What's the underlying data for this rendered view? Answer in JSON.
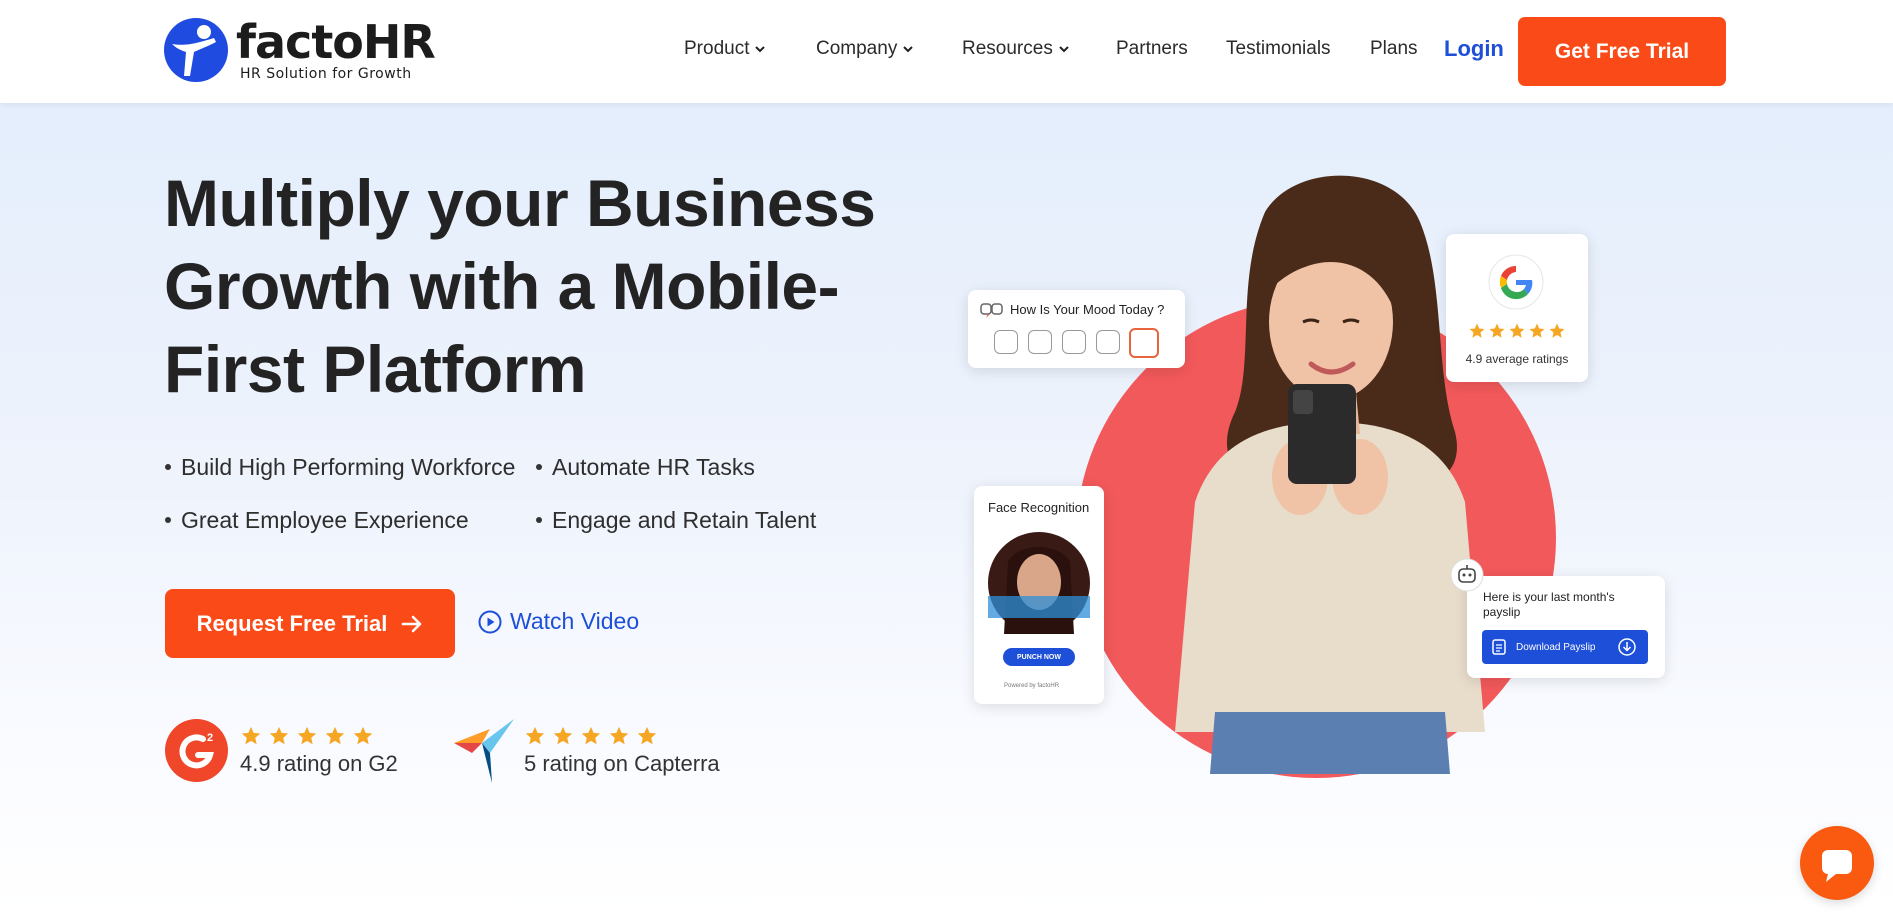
{
  "header": {
    "logo_name": "factoHR",
    "logo_tagline": "HR Solution for Growth",
    "nav": [
      {
        "label": "Product",
        "has_dropdown": true
      },
      {
        "label": "Company",
        "has_dropdown": true
      },
      {
        "label": "Resources",
        "has_dropdown": true
      },
      {
        "label": "Partners",
        "has_dropdown": false
      },
      {
        "label": "Testimonials",
        "has_dropdown": false
      },
      {
        "label": "Plans",
        "has_dropdown": false
      }
    ],
    "login_label": "Login",
    "cta_label": "Get Free Trial"
  },
  "hero": {
    "headline_lines": [
      "Multiply your Business",
      "Growth with a Mobile-",
      "First Platform"
    ],
    "bullets": [
      "Build High Performing Workforce",
      "Automate HR Tasks",
      "Great Employee Experience",
      "Engage and Retain Talent"
    ],
    "primary_cta": "Request Free Trial",
    "secondary_cta": "Watch Video",
    "ratings": [
      {
        "badge": "G2",
        "stars": 5,
        "text": "4.9 rating on G2"
      },
      {
        "badge": "Capterra",
        "stars": 5,
        "text": "5 rating on Capterra"
      }
    ]
  },
  "cards": {
    "mood": {
      "title": "How Is Your Mood Today ?"
    },
    "google": {
      "stars": 5,
      "text": "4.9 average ratings"
    },
    "face": {
      "title": "Face Recognition",
      "button": "PUNCH NOW",
      "powered": "Powered by factoHR"
    },
    "payslip": {
      "text": "Here is your last month's payslip",
      "button": "Download Payslip"
    }
  },
  "colors": {
    "brand_orange": "#fa4a17",
    "brand_blue": "#1d4fd8",
    "hero_circle": "#f2595b",
    "star": "#f5a623"
  }
}
